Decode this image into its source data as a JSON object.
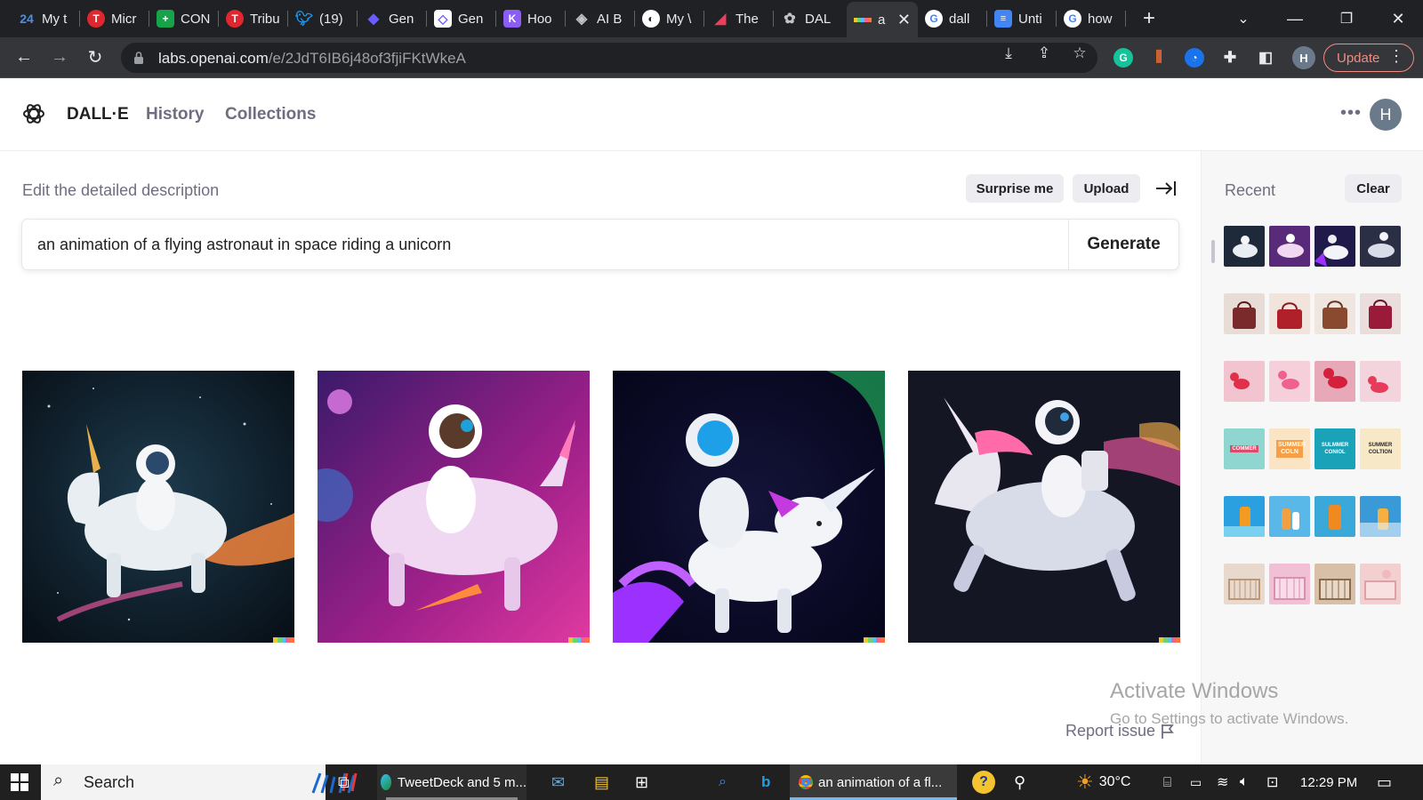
{
  "browser": {
    "tabs": [
      {
        "title": "My t",
        "icon": "site-24-icon",
        "color": "#3b5998"
      },
      {
        "title": "Micr",
        "icon": "tribune-t-icon",
        "color": "#e0262f"
      },
      {
        "title": "CON",
        "icon": "green-plus-icon",
        "color": "#17a34a"
      },
      {
        "title": "Tribu",
        "icon": "tribune-t-icon",
        "color": "#e0262f"
      },
      {
        "title": "(19)",
        "icon": "twitter-icon",
        "color": "#1d9bf0"
      },
      {
        "title": "Gen",
        "icon": "diamond-icon",
        "color": "#6b5cff"
      },
      {
        "title": "Gen",
        "icon": "diamond-outline-icon",
        "color": "#6b5cff"
      },
      {
        "title": "Hoo",
        "icon": "k-logo-icon",
        "color": "#8b5cf6"
      },
      {
        "title": "AI B",
        "icon": "ai-diamond-icon",
        "color": "#9aa0a6"
      },
      {
        "title": "My \\",
        "icon": "globe-icon",
        "color": "#e8eaed"
      },
      {
        "title": "The",
        "icon": "red-swoosh-icon",
        "color": "#ef3e5c"
      },
      {
        "title": "DAL",
        "icon": "openai-icon",
        "color": "#9aa0a6"
      },
      {
        "title": "a",
        "icon": "dalle-strip-icon",
        "color": "#f4c430"
      },
      {
        "title": "dall",
        "icon": "google-g-icon",
        "color": "#4285f4"
      },
      {
        "title": "Unti",
        "icon": "docs-icon",
        "color": "#4285f4"
      },
      {
        "title": "how",
        "icon": "google-g-icon",
        "color": "#4285f4"
      }
    ],
    "url_host": "labs.openai.com",
    "url_path": "/e/2JdT6IB6j48of3fjiFKtWkeA",
    "update_label": "Update",
    "profile_initial": "H"
  },
  "app": {
    "brand": "DALL·E",
    "nav": [
      "History",
      "Collections"
    ],
    "avatar_initial": "H",
    "editor": {
      "label": "Edit the detailed description",
      "surprise_label": "Surprise me",
      "upload_label": "Upload",
      "prompt": "an animation of a flying astronaut in space riding a unicorn",
      "generate_label": "Generate"
    },
    "results": [
      {
        "subject": "astronaut riding white unicorn in starry space",
        "accent": "#ff8a3d"
      },
      {
        "subject": "astronaut riding pink unicorn on magenta background",
        "accent": "#ff4fa0"
      },
      {
        "subject": "astronaut riding white unicorn with purple tail",
        "accent": "#9b30ff"
      },
      {
        "subject": "astronaut riding pale unicorn with rainbow mane",
        "accent": "#ff5fae"
      }
    ],
    "report_label": "Report issue",
    "recent": {
      "title": "Recent",
      "clear_label": "Clear",
      "groups": [
        {
          "subject": "astronaut unicorn",
          "tones": [
            "#1e2a3a",
            "#5a2a7a",
            "#201a4a",
            "#2a2f45"
          ]
        },
        {
          "subject": "red handbag",
          "tones": [
            "#7a2a2a",
            "#b0202a",
            "#8a4a30",
            "#9a1a3a"
          ]
        },
        {
          "subject": "pink balloon dog",
          "tones": [
            "#f2c4cf",
            "#f5d0da",
            "#e7a8b8",
            "#f4d4dc"
          ]
        },
        {
          "subject": "summer collection poster",
          "tones": [
            "#8fd6d0",
            "#f4a04a",
            "#1aa3b8",
            "#f7e9c8"
          ]
        },
        {
          "subject": "sunscreen bottle pool",
          "tones": [
            "#2aa0e0",
            "#5ab8e8",
            "#f0a040",
            "#3a9ad8"
          ]
        },
        {
          "subject": "baby crib nursery",
          "tones": [
            "#e9d8cc",
            "#f2c0d4",
            "#d8bfa8",
            "#f2d0d0"
          ]
        }
      ],
      "thumb_texts": {
        "poster_a": "COMMER",
        "poster_b": "SUMMER COLN",
        "poster_c": "SULMMER CONIOL",
        "poster_d": "SUMMER COLTION"
      }
    }
  },
  "watermark": {
    "title": "Activate Windows",
    "subtitle": "Go to Settings to activate Windows."
  },
  "taskbar": {
    "search_label": "Search",
    "apps": [
      {
        "label": "TweetDeck and 5 m...",
        "icon": "edge-icon"
      },
      {
        "label": "an animation of a fl...",
        "icon": "chrome-icon"
      }
    ],
    "temperature": "30°C",
    "time": "12:29 PM"
  }
}
